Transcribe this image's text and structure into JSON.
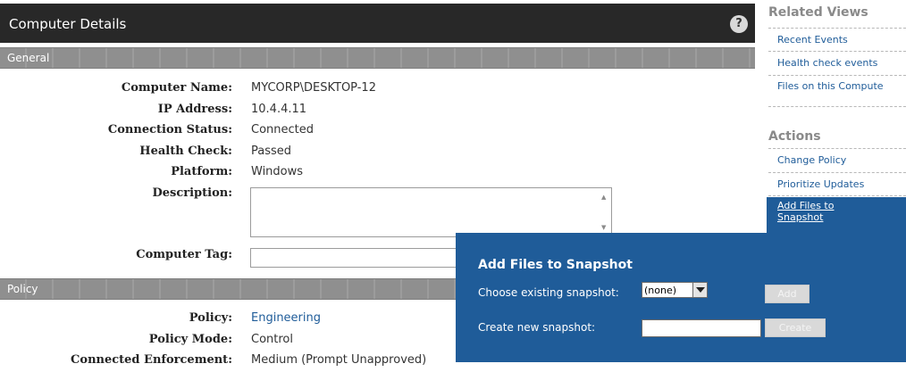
{
  "header": {
    "title": "Computer Details",
    "help_label": "?"
  },
  "sections": {
    "general": "General",
    "policy": "Policy"
  },
  "general": {
    "computer_name": {
      "label": "Computer Name:",
      "value": "MYCORP\\DESKTOP-12"
    },
    "ip_address": {
      "label": "IP Address:",
      "value": "10.4.4.11"
    },
    "connection_status": {
      "label": "Connection Status:",
      "value": "Connected"
    },
    "health_check": {
      "label": "Health Check:",
      "value": "Passed"
    },
    "platform": {
      "label": "Platform:",
      "value": "Windows"
    },
    "description": {
      "label": "Description:",
      "value": ""
    },
    "computer_tag": {
      "label": "Computer Tag:",
      "value": ""
    }
  },
  "policy": {
    "policy": {
      "label": "Policy:",
      "value": "Engineering"
    },
    "policy_mode": {
      "label": "Policy Mode:",
      "value": "Control"
    },
    "enforcement": {
      "label": "Connected Enforcement:",
      "value": "Medium (Prompt Unapproved)"
    }
  },
  "sidebar": {
    "related_title": "Related Views",
    "related": [
      "Recent Events",
      "Health check events",
      "Files on this Compute"
    ],
    "actions_title": "Actions",
    "actions": [
      "Change Policy",
      "Prioritize Updates",
      "Add Files to Snapshot"
    ]
  },
  "popup": {
    "title": "Add Files to Snapshot",
    "existing_label": "Choose existing snapshot:",
    "existing_value": "(none)",
    "add_label": "Add",
    "new_label": "Create new snapshot:",
    "new_value": "",
    "create_label": "Create"
  },
  "colors": {
    "accent": "#1f5c99",
    "titlebar": "#282828",
    "section": "#8f8f8f"
  }
}
